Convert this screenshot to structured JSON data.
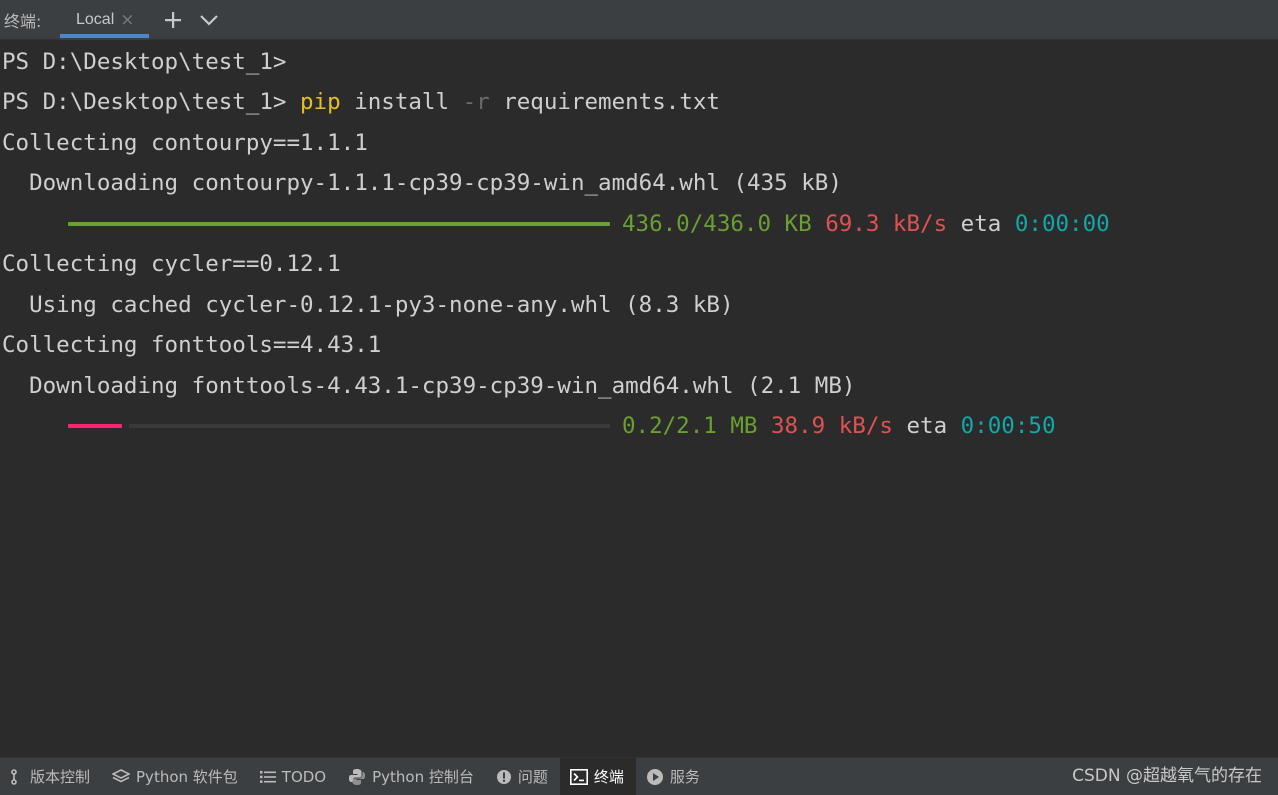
{
  "tabbar": {
    "title": "终端:",
    "tabs": [
      {
        "label": "Local"
      }
    ],
    "close_glyph": "×",
    "add_icon": "plus-icon",
    "menu_icon": "chevron-down-icon"
  },
  "terminal": {
    "lines": [
      {
        "prompt": "PS D:\\Desktop\\test_1>"
      },
      {
        "prompt": "PS D:\\Desktop\\test_1> ",
        "cmd": "pip",
        "arg1": " install ",
        "flag": "-r",
        "arg2": " requirements.txt"
      },
      {
        "text": "Collecting contourpy==1.1.1"
      },
      {
        "text": "  Downloading contourpy-1.1.1-cp39-cp39-win_amd64.whl (435 kB)"
      },
      {
        "progress": {
          "fraction": 1.0,
          "size": "436.0/436.0 KB",
          "speed": "69.3 kB/s",
          "eta_label": "eta",
          "eta": "0:00:00"
        }
      },
      {
        "text": "Collecting cycler==0.12.1"
      },
      {
        "text": "  Using cached cycler-0.12.1-py3-none-any.whl (8.3 kB)"
      },
      {
        "text": "Collecting fonttools==4.43.1"
      },
      {
        "text": "  Downloading fonttools-4.43.1-cp39-cp39-win_amd64.whl (2.1 MB)"
      },
      {
        "progress": {
          "fraction": 0.1,
          "size": "0.2/2.1 MB",
          "speed": "38.9 kB/s",
          "eta_label": "eta",
          "eta": "0:00:50"
        }
      }
    ]
  },
  "colors": {
    "background": "#2b2b2b",
    "bar_complete": "#6a9f31",
    "bar_partial": "#f92672",
    "bar_track": "#3a3a3a",
    "command": "#e3c21b",
    "size": "#6a9f31",
    "speed": "#e05252",
    "eta": "#11a8a8"
  },
  "statusbar": {
    "items": [
      {
        "label": "版本控制",
        "icon": "branch-icon"
      },
      {
        "label": "Python 软件包",
        "icon": "layers-icon"
      },
      {
        "label": "TODO",
        "icon": "list-icon"
      },
      {
        "label": "Python 控制台",
        "icon": "python-icon"
      },
      {
        "label": "问题",
        "icon": "warning-circle-icon"
      },
      {
        "label": "终端",
        "icon": "terminal-icon",
        "active": true
      },
      {
        "label": "服务",
        "icon": "play-circle-icon"
      }
    ],
    "watermark": "CSDN @超越氧气的存在"
  }
}
